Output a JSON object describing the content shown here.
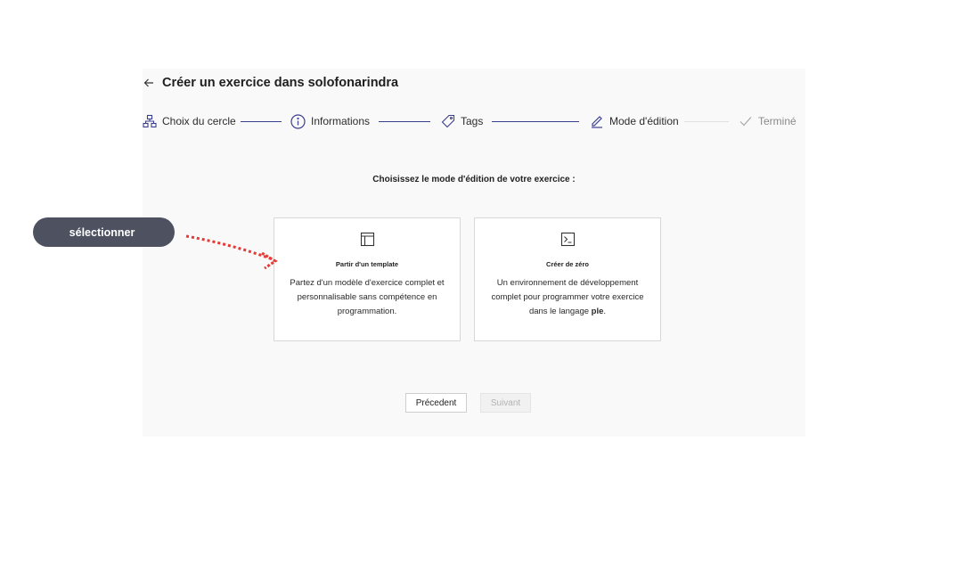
{
  "header": {
    "back_icon": "arrow-left-icon",
    "title": "Créer un exercice dans solofonarindra"
  },
  "stepper": {
    "steps": [
      {
        "label": "Choix du cercle",
        "icon": "sitemap-icon",
        "state": "done"
      },
      {
        "label": "Informations",
        "icon": "info-circle-icon",
        "state": "done"
      },
      {
        "label": "Tags",
        "icon": "tag-icon",
        "state": "done"
      },
      {
        "label": "Mode d'édition",
        "icon": "pencil-icon",
        "state": "active"
      },
      {
        "label": "Terminé",
        "icon": "check-icon",
        "state": "pending"
      }
    ]
  },
  "prompt": "Choisissez le mode d'édition de votre exercice :",
  "cards": [
    {
      "icon": "layout-template-icon",
      "title": "Partir d'un template",
      "description": "Partez d'un modèle d'exercice complet et personnalisable sans compétence en programmation."
    },
    {
      "icon": "terminal-icon",
      "title": "Créer de zéro",
      "description_before": "Un environnement de développement complet pour programmer votre exercice dans le langage ",
      "description_bold": "ple",
      "description_after": "."
    }
  ],
  "buttons": {
    "previous": "Précedent",
    "next": "Suivant"
  },
  "annotation": {
    "label": "sélectionner",
    "arrow_color": "#e53935"
  },
  "colors": {
    "accent": "#3b3f8f",
    "pill_bg": "#4d5160"
  }
}
